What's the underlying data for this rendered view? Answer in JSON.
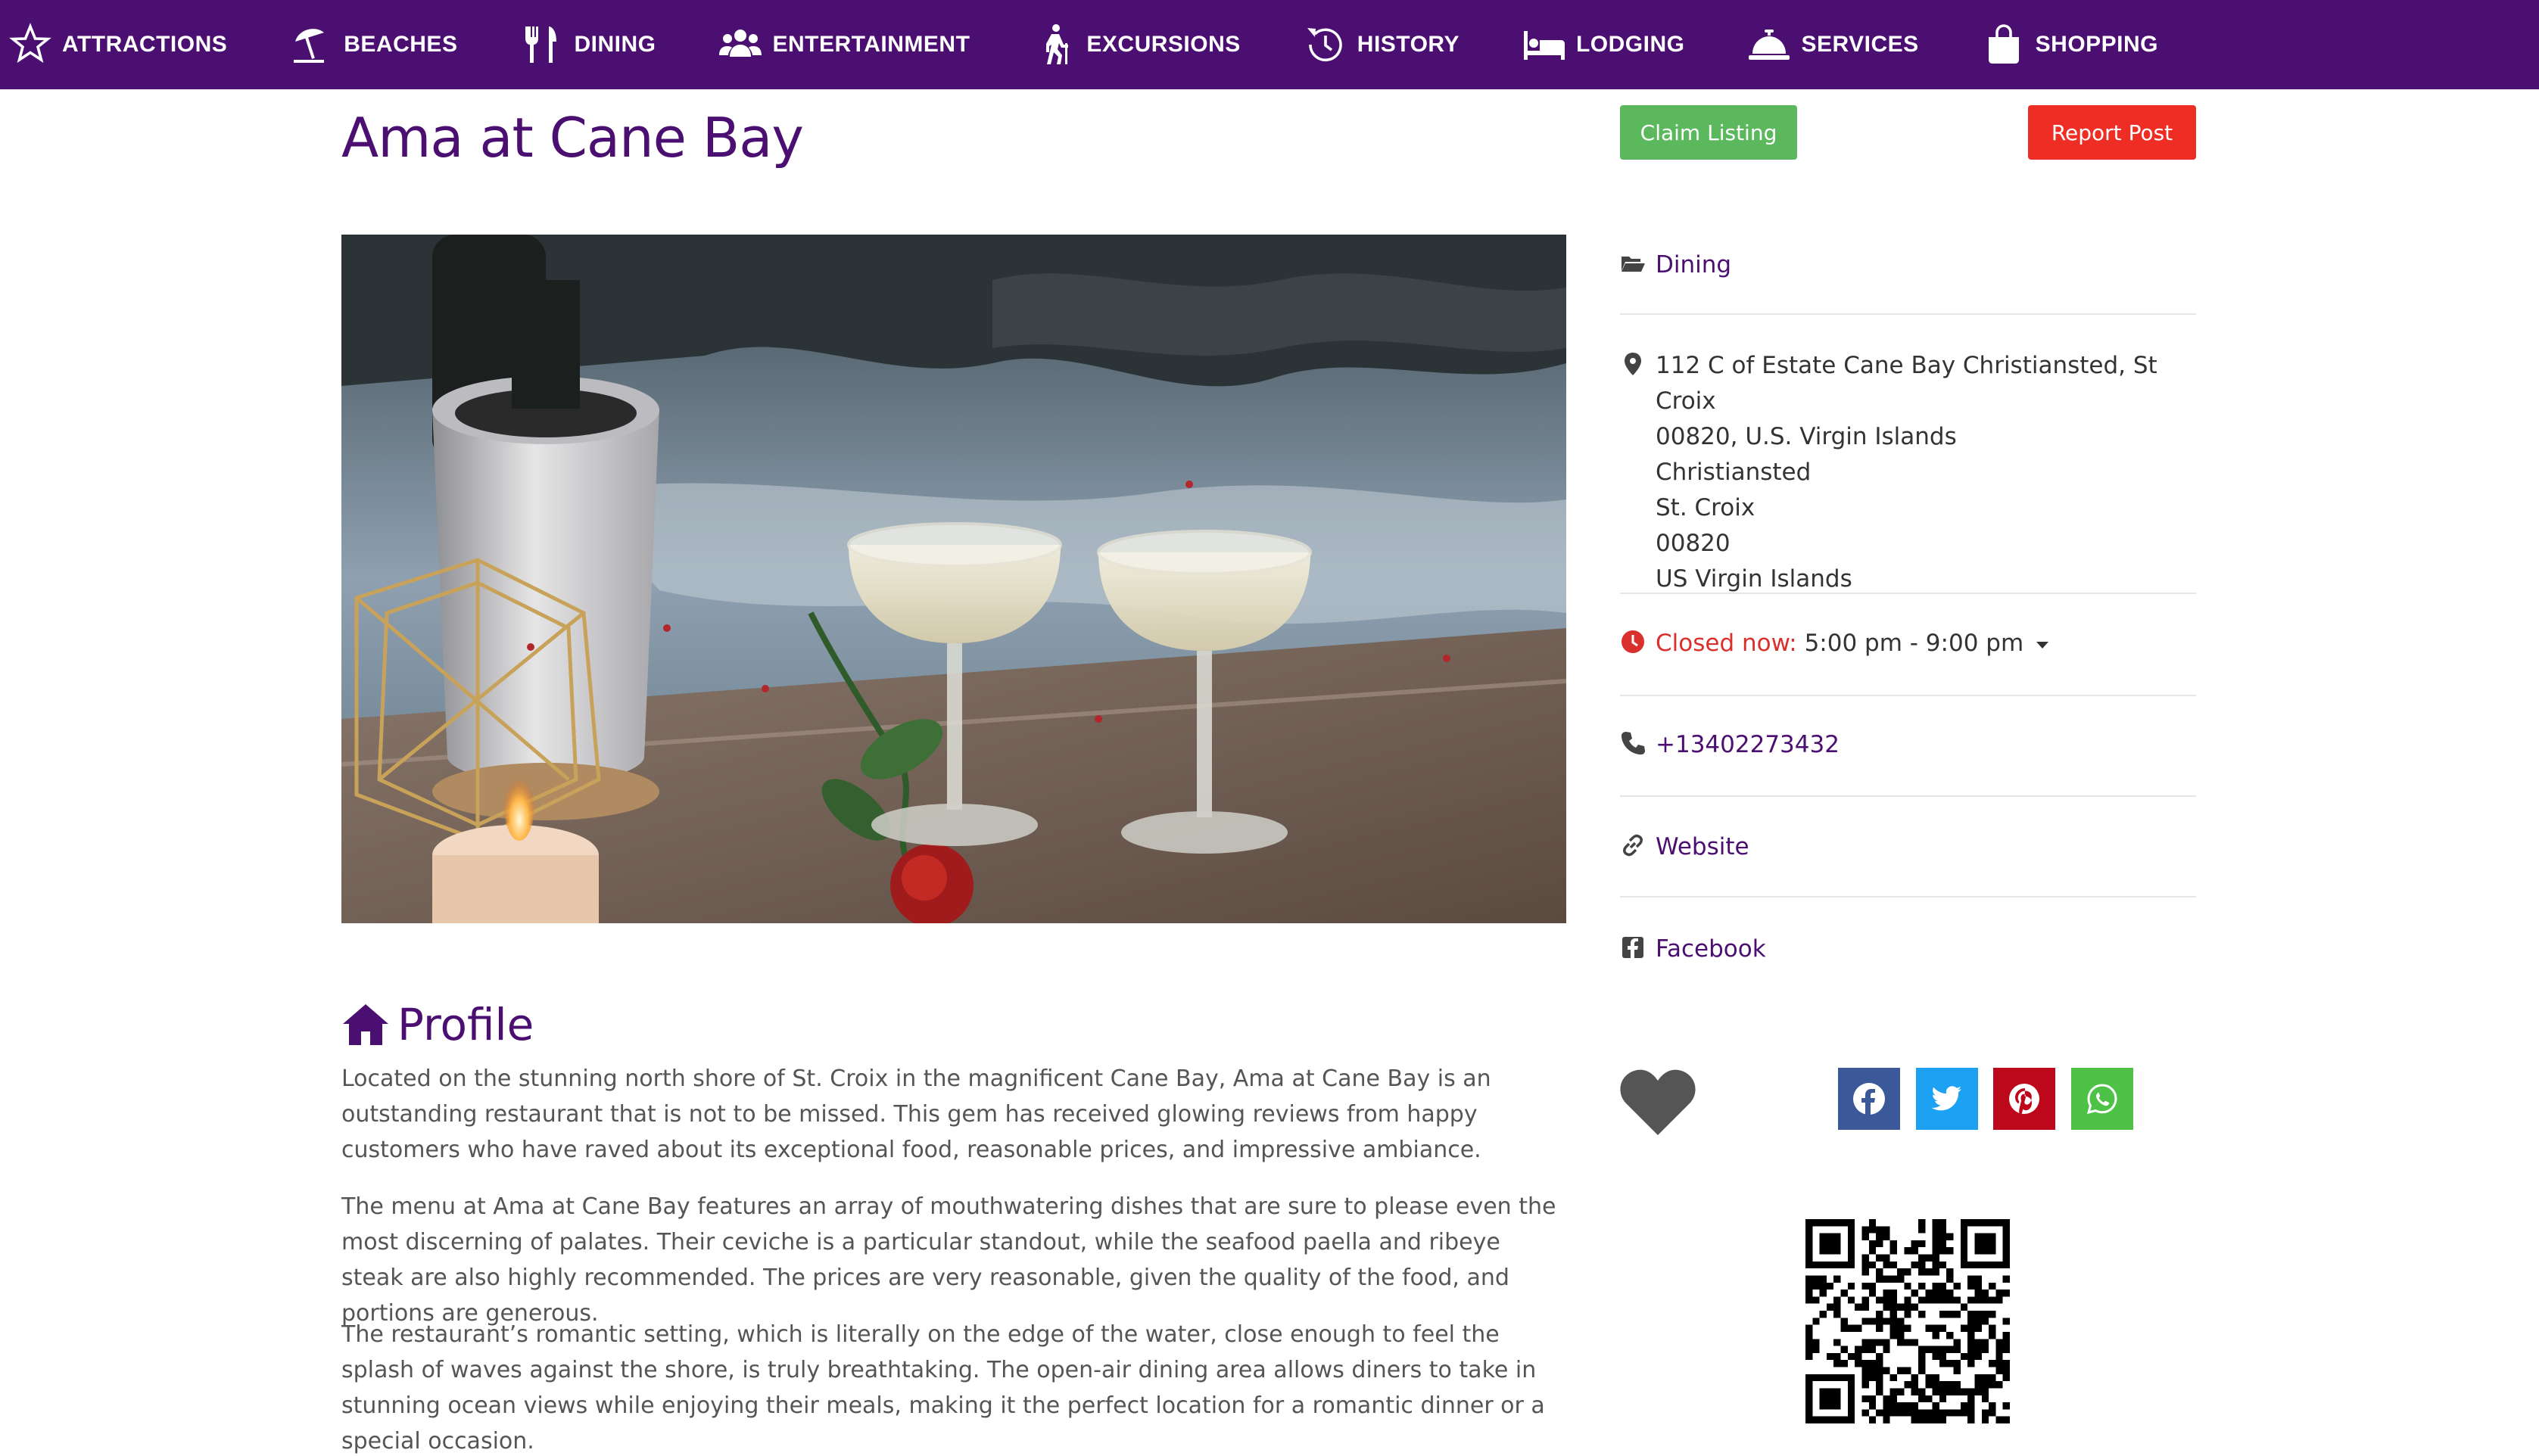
{
  "nav": {
    "items": [
      {
        "label": "ATTRACTIONS",
        "icon": "star-icon"
      },
      {
        "label": "BEACHES",
        "icon": "beach-umbrella-icon"
      },
      {
        "label": "DINING",
        "icon": "utensils-icon"
      },
      {
        "label": "ENTERTAINMENT",
        "icon": "users-icon"
      },
      {
        "label": "EXCURSIONS",
        "icon": "hiking-icon"
      },
      {
        "label": "HISTORY",
        "icon": "history-icon"
      },
      {
        "label": "LODGING",
        "icon": "bed-icon"
      },
      {
        "label": "SERVICES",
        "icon": "concierge-bell-icon"
      },
      {
        "label": "SHOPPING",
        "icon": "shopping-bag-icon"
      }
    ],
    "background": "#4b0f72"
  },
  "listing": {
    "title": "Ama at Cane Bay",
    "claim_label": "Claim Listing",
    "report_label": "Report Post"
  },
  "sidebar": {
    "category": "Dining",
    "address": {
      "line1": "112 C of Estate Cane Bay Christiansted, St Croix",
      "line2": "00820, U.S. Virgin Islands",
      "city": "Christiansted",
      "region": "St. Croix",
      "zip": "00820",
      "country": "US Virgin Islands"
    },
    "hours": {
      "status": "Closed now:",
      "range": "5:00 pm - 9:00 pm"
    },
    "phone": "+13402273432",
    "website": "Website",
    "facebook": "Facebook"
  },
  "profile": {
    "heading": "Profile",
    "paragraphs": [
      "Located on the stunning north shore of St. Croix in the magnificent Cane Bay, Ama at Cane Bay is an outstanding restaurant that is not to be missed. This gem has received glowing reviews from happy customers who have raved about its exceptional food, reasonable prices, and impressive ambiance.",
      "The menu at Ama at Cane Bay features an array of mouthwatering dishes that are sure to please even the most discerning of palates. Their ceviche is a particular standout, while the seafood paella and ribeye steak are also highly recommended. The prices are very reasonable, given the quality of the food, and portions are generous.",
      "The restaurant’s romantic setting, which is literally on the edge of the water, close enough to feel the splash of waves against the shore, is truly breathtaking. The open-air dining area allows diners to take in stunning ocean views while enjoying their meals, making it the perfect location for a romantic dinner or a special occasion."
    ]
  },
  "share": {
    "buttons": [
      {
        "name": "facebook-share-button",
        "color": "#3b5998"
      },
      {
        "name": "twitter-share-button",
        "color": "#1da1f2"
      },
      {
        "name": "pinterest-share-button",
        "color": "#bd081c"
      },
      {
        "name": "whatsapp-share-button",
        "color": "#4dc247"
      }
    ]
  }
}
